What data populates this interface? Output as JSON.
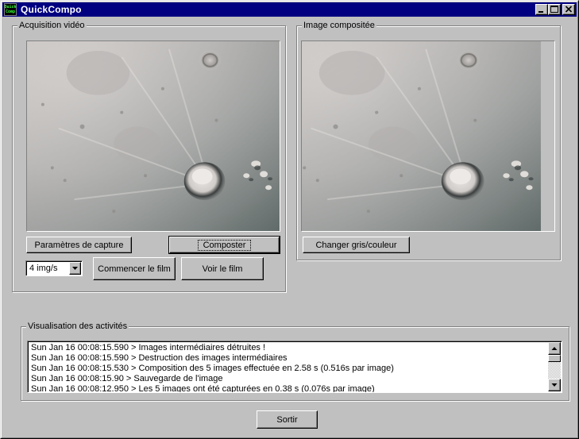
{
  "window": {
    "title": "QuickCompo",
    "icon_text": [
      "Quick",
      "Comp"
    ]
  },
  "acquisition": {
    "label": "Acquisition vidéo",
    "capture_params_button": "Paramètres de capture",
    "compose_button": "Composter",
    "rate_select": {
      "value": "4 img/s"
    },
    "start_film_button": "Commencer le film",
    "view_film_button": "Voir le film"
  },
  "composite": {
    "label": "Image compositée",
    "toggle_color_button": "Changer gris/couleur"
  },
  "activity": {
    "label": "Visualisation des activités",
    "lines": [
      "Sun Jan 16 00:08:15.590  > Images intermédiaires détruites !",
      "Sun Jan 16 00:08:15.590  > Destruction des images intermédiaires",
      "Sun Jan 16 00:08:15.530  > Composition des 5 images effectuée en 2.58 s (0.516s par image)",
      "Sun Jan 16 00:08:15.90  > Sauvegarde de l'image",
      "Sun Jan 16 00:08:12.950  > Les 5 images ont été capturées en 0.38 s (0.076s par image)"
    ]
  },
  "footer": {
    "exit_button": "Sortir"
  },
  "colors": {
    "titlebar": "#000080",
    "face": "#c0c0c0"
  }
}
